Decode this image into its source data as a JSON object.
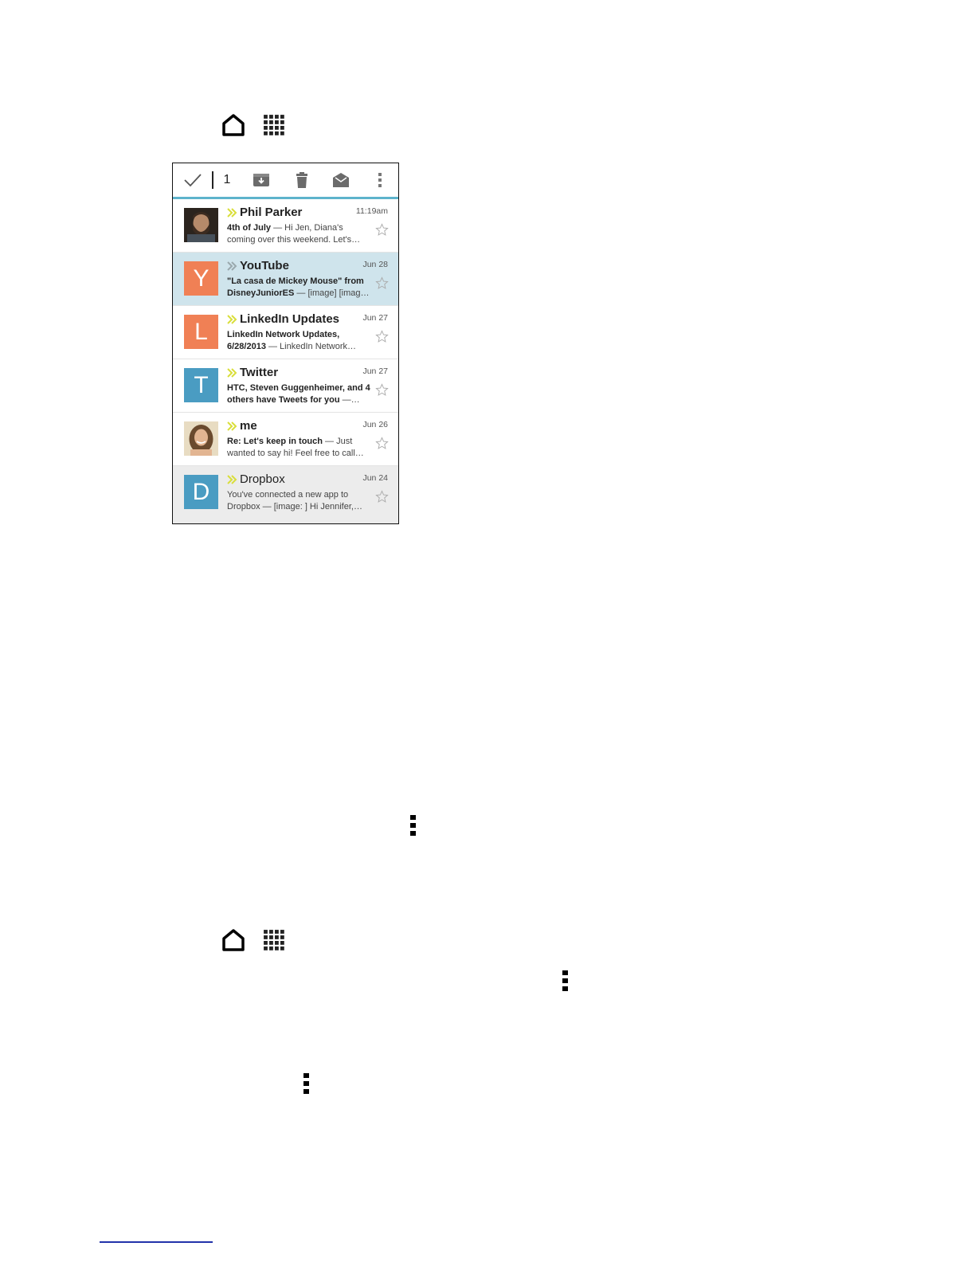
{
  "icons": {
    "home": "home-icon",
    "apps": "apps-grid-icon",
    "more": "more-vertical-icon"
  },
  "toolbar": {
    "selected_count": "1"
  },
  "colors": {
    "accent": "#5db3cc",
    "selected_row": "#cfe4ec",
    "avatar_orange": "#f08055",
    "avatar_blue": "#4a9cc2",
    "chevron_yellow": "#d9de3a"
  },
  "emails": [
    {
      "sender": "Phil Parker",
      "date": "11:19am",
      "subject": "4th of July",
      "line1_rest": " — Hi Jen, Diana's",
      "line2": "coming over this weekend. Let's…",
      "avatar_letter": "",
      "unread": true,
      "chevron": "yellow"
    },
    {
      "sender": "YouTube",
      "date": "Jun 28",
      "subject": "\"La casa de Mickey Mouse\" from",
      "line1_rest": "",
      "line2_subject": "DisneyJuniorES",
      "line2": " — [image] [imag…",
      "avatar_letter": "Y",
      "unread": true,
      "chevron": "gray"
    },
    {
      "sender": "LinkedIn Updates",
      "date": "Jun 27",
      "subject": "LinkedIn Network Updates,",
      "line1_rest": "",
      "line2_subject": "6/28/2013",
      "line2": " — LinkedIn Network…",
      "avatar_letter": "L",
      "unread": true,
      "chevron": "yellow"
    },
    {
      "sender": "Twitter",
      "date": "Jun 27",
      "subject": "HTC, Steven Guggenheimer, and 4",
      "line1_rest": "",
      "line2_subject": "others have Tweets for you",
      "line2": " —…",
      "avatar_letter": "T",
      "unread": true,
      "chevron": "yellow"
    },
    {
      "sender": "me",
      "date": "Jun 26",
      "subject": "Re: Let's keep in touch",
      "line1_rest": " — Just",
      "line2": "wanted to say hi! Feel free to call…",
      "avatar_letter": "",
      "unread": true,
      "chevron": "yellow"
    },
    {
      "sender": "Dropbox",
      "date": "Jun 24",
      "subject": "",
      "line1_rest": "You've connected a new app to",
      "line2": "Dropbox — [image: ] Hi Jennifer,…",
      "avatar_letter": "D",
      "unread": false,
      "chevron": "yellow"
    }
  ]
}
